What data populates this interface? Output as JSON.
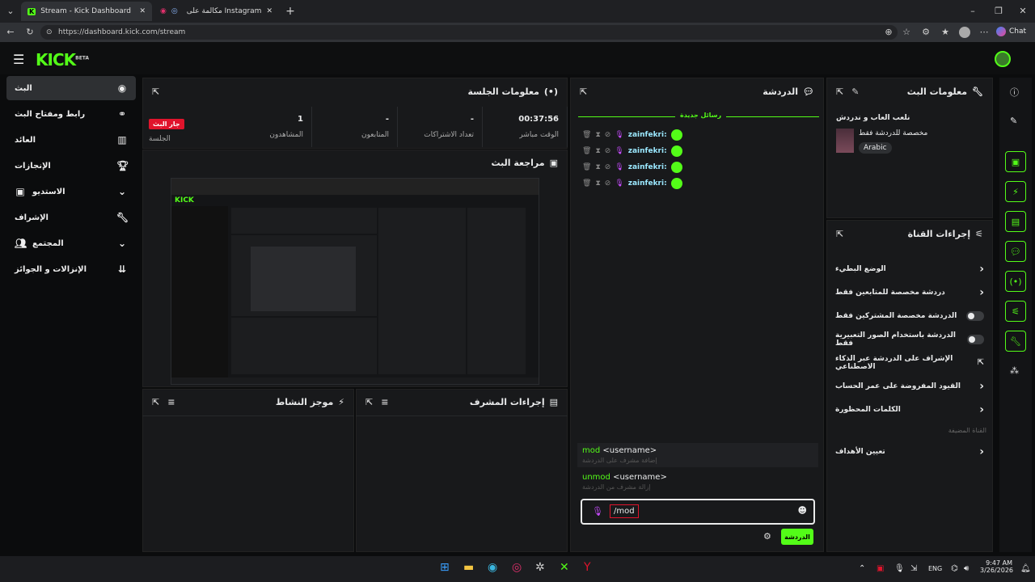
{
  "browser": {
    "tab1_title": "Stream - Kick Dashboard",
    "tab2_title": "مكالمة على Instagram",
    "url": "https://dashboard.kick.com/stream",
    "copilot_label": "Chat"
  },
  "header": {
    "logo": "KICK",
    "logo_beta": "BETA"
  },
  "sidebar": {
    "items": [
      {
        "label": "البث"
      },
      {
        "label": "رابط ومفتاح البث"
      },
      {
        "label": "العائد"
      },
      {
        "label": "الإنجازات"
      },
      {
        "label": "الاستديو"
      },
      {
        "label": "الإشراف"
      },
      {
        "label": "المجتمع"
      },
      {
        "label": "الإنزالات و الجوائز"
      }
    ]
  },
  "session": {
    "title": "معلومات الجلسة",
    "live_badge": "جار البث",
    "session_label": "الجلسة",
    "stats": [
      {
        "value": "00:37:56",
        "label": "الوقت مباشر"
      },
      {
        "value": "-",
        "label": "تعداد الاشتراكات"
      },
      {
        "value": "-",
        "label": "المتابعون"
      },
      {
        "value": "1",
        "label": "المشاهدون"
      }
    ]
  },
  "preview": {
    "title": "مراجعة البث"
  },
  "activity": {
    "title": "موجز النشاط"
  },
  "mod_actions": {
    "title": "إجراءات المشرف"
  },
  "chat": {
    "title": "الدردشة",
    "new_messages": "رسائل جديدة",
    "messages": [
      {
        "user": "zainfekri:"
      },
      {
        "user": "zainfekri:"
      },
      {
        "user": "zainfekri:"
      },
      {
        "user": "zainfekri:"
      }
    ],
    "autocomplete": [
      {
        "cmd_hl": "mod",
        "cmd_rest": " <username>",
        "desc": "إضافة مشرف على الدردشة"
      },
      {
        "cmd_hl": "unmod",
        "cmd_rest": " <username>",
        "desc": "إزالة مشرف من الدردشة"
      }
    ],
    "input_value": "/mod",
    "send_label": "الدردشة"
  },
  "stream_info": {
    "title": "معلومات البث",
    "stream_title": "نلعب العاب و ندردش",
    "category": "مخصصة للدردشة فقط",
    "language_tag": "Arabic"
  },
  "channel_actions": {
    "title": "إجراءات القناة",
    "items": [
      {
        "label": "الوضع البطيء",
        "control": "arrow"
      },
      {
        "label": "دردشة مخصصة للمتابعين فقط",
        "control": "arrow"
      },
      {
        "label": "الدردشة مخصصة المشتركين فقط",
        "control": "toggle"
      },
      {
        "label": "الدردشة باستخدام الصور التعبيرية فقط",
        "control": "toggle"
      },
      {
        "label": "الإشراف على الدردشة عبر الذكاء الاصطناعي",
        "control": "external"
      },
      {
        "label": "القيود المفروضة على عمر الحساب",
        "control": "arrow"
      },
      {
        "label": "الكلمات المحظورة",
        "control": "arrow"
      }
    ],
    "featured_section": "القناة المضيفة",
    "goals_item": "تعيين الأهداف"
  },
  "taskbar": {
    "time": "9:47 AM",
    "date": "3/26/2026",
    "lang": "ENG"
  },
  "colors": {
    "accent": "#53fc18",
    "panel": "#18191b",
    "bg": "#0b0c0d",
    "live": "#e0142c"
  }
}
